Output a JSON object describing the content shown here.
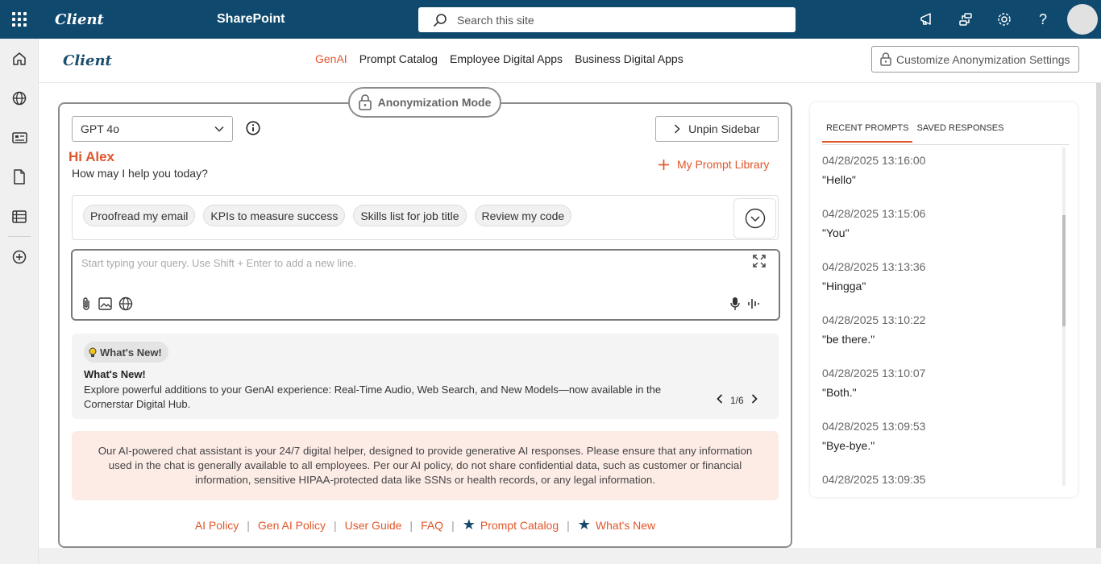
{
  "suitebar": {
    "brand": "Client",
    "app_title": "SharePoint",
    "search_placeholder": "Search this site"
  },
  "sitenav": {
    "logo": "Client",
    "links": [
      "GenAI",
      "Prompt Catalog",
      "Employee Digital Apps",
      "Business Digital Apps"
    ],
    "active_link": "GenAI",
    "customize_button": "Customize Anonymization Settings"
  },
  "chat": {
    "mode_label": "Anonymization Mode",
    "model_selected": "GPT 4o",
    "unpin_label": "Unpin Sidebar",
    "greeting_name": "Hi Alex",
    "greeting_sub": "How may I help you today?",
    "prompt_library_label": "My Prompt Library",
    "chips": [
      "Proofread my email",
      "KPIs to measure success",
      "Skills list for job title",
      "Review my code"
    ],
    "query_placeholder": "Start typing your query. Use Shift + Enter to add a new line."
  },
  "whats_new": {
    "badge": "What's New!",
    "title": "What's New!",
    "description": "Explore powerful additions to your GenAI experience: Real-Time Audio, Web Search, and New Models—now available in the Cornerstar Digital Hub.",
    "pager": "1/6"
  },
  "disclaimer": "Our AI-powered chat assistant is your 24/7 digital helper, designed to provide generative AI responses. Please ensure that any information used in the chat is generally available to all employees. Per our AI policy, do not share confidential data, such as customer or financial information, sensitive HIPAA-protected data like SSNs or health records, or any legal information.",
  "footer": {
    "ai_policy": "AI Policy",
    "gen_ai_policy": "Gen AI Policy",
    "user_guide": "User Guide",
    "faq": "FAQ",
    "prompt_catalog": "Prompt Catalog",
    "whats_new": "What's New"
  },
  "recent": {
    "tabs": [
      "RECENT PROMPTS",
      "SAVED RESPONSES"
    ],
    "active_tab": "RECENT PROMPTS",
    "items": [
      {
        "time": "04/28/2025 13:16:00",
        "text": "\"Hello\""
      },
      {
        "time": "04/28/2025 13:15:06",
        "text": "\"You\""
      },
      {
        "time": "04/28/2025 13:13:36",
        "text": "\"Hingga\""
      },
      {
        "time": "04/28/2025 13:10:22",
        "text": "\"be there.\""
      },
      {
        "time": "04/28/2025 13:10:07",
        "text": "\"Both.\""
      },
      {
        "time": "04/28/2025 13:09:53",
        "text": "\"Bye-bye.\""
      },
      {
        "time": "04/28/2025 13:09:35",
        "text": ""
      }
    ]
  },
  "colors": {
    "suitebar": "#0f4a6e",
    "accent": "#e0562a",
    "star": "#17496b"
  }
}
